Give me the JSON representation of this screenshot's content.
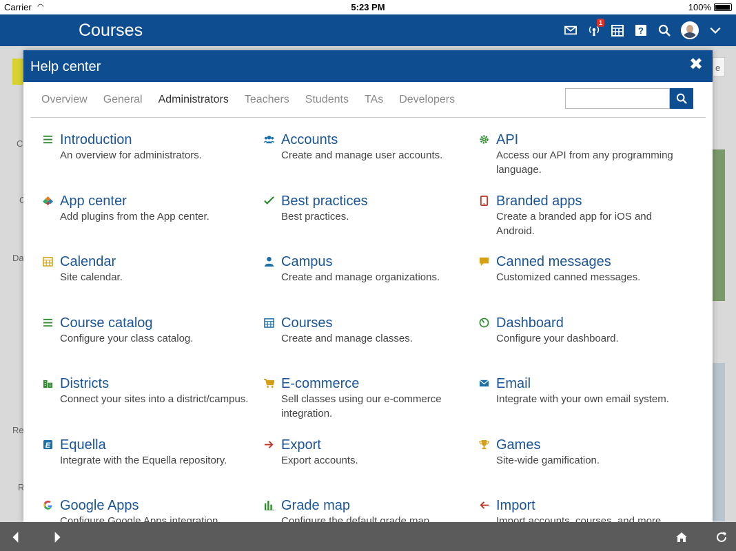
{
  "status_bar": {
    "carrier": "Carrier",
    "time": "5:23 PM",
    "battery": "100%"
  },
  "app": {
    "title": "Courses",
    "notification_count": "1"
  },
  "background_fragments": [
    "C",
    "C",
    "Da",
    "Re",
    "R",
    "e"
  ],
  "modal": {
    "title": "Help center",
    "close_icon": "close-icon",
    "tabs": [
      {
        "label": "Overview"
      },
      {
        "label": "General"
      },
      {
        "label": "Administrators",
        "active": true
      },
      {
        "label": "Teachers"
      },
      {
        "label": "Students"
      },
      {
        "label": "TAs"
      },
      {
        "label": "Developers"
      }
    ],
    "search_placeholder": "",
    "topics": [
      {
        "title": "Introduction",
        "desc": "An overview for administrators.",
        "icon": "list-icon",
        "color": "#2e8b2e"
      },
      {
        "title": "Accounts",
        "desc": "Create and manage user accounts.",
        "icon": "users-icon",
        "color": "#1d6fa5"
      },
      {
        "title": "API",
        "desc": "Access our API from any programming language.",
        "icon": "gear-icon",
        "color": "#2e8b2e"
      },
      {
        "title": "App center",
        "desc": "Add plugins from the App center.",
        "icon": "puzzle-icon",
        "color": "#3a7bd5"
      },
      {
        "title": "Best practices",
        "desc": "Best practices.",
        "icon": "check-icon",
        "color": "#2e8b2e"
      },
      {
        "title": "Branded apps",
        "desc": "Create a branded app for iOS and Android.",
        "icon": "phone-icon",
        "color": "#c0392b"
      },
      {
        "title": "Calendar",
        "desc": "Site calendar.",
        "icon": "calendar-icon",
        "color": "#d4a017"
      },
      {
        "title": "Campus",
        "desc": "Create and manage organizations.",
        "icon": "person-icon",
        "color": "#1d6fa5"
      },
      {
        "title": "Canned messages",
        "desc": "Customized canned messages.",
        "icon": "chat-icon",
        "color": "#d4a017"
      },
      {
        "title": "Course catalog",
        "desc": "Configure your class catalog.",
        "icon": "list-icon",
        "color": "#2e8b2e"
      },
      {
        "title": "Courses",
        "desc": "Create and manage classes.",
        "icon": "calendar-icon",
        "color": "#1d6fa5"
      },
      {
        "title": "Dashboard",
        "desc": "Configure your dashboard.",
        "icon": "gauge-icon",
        "color": "#2e8b2e"
      },
      {
        "title": "Districts",
        "desc": "Connect your sites into a district/campus.",
        "icon": "building-icon",
        "color": "#2e8b2e"
      },
      {
        "title": "E-commerce",
        "desc": "Sell classes using our e-commerce integration.",
        "icon": "cart-icon",
        "color": "#d4a017"
      },
      {
        "title": "Email",
        "desc": "Integrate with your own email system.",
        "icon": "mail-icon",
        "color": "#1d6fa5"
      },
      {
        "title": "Equella",
        "desc": "Integrate with the Equella repository.",
        "icon": "equella-icon",
        "color": "#1d6fa5"
      },
      {
        "title": "Export",
        "desc": "Export accounts.",
        "icon": "arrow-right-icon",
        "color": "#c0392b"
      },
      {
        "title": "Games",
        "desc": "Site-wide gamification.",
        "icon": "trophy-icon",
        "color": "#d4a017"
      },
      {
        "title": "Google Apps",
        "desc": "Configure Google Apps integration.",
        "icon": "google-icon",
        "color": "#4285f4"
      },
      {
        "title": "Grade map",
        "desc": "Configure the default grade map.",
        "icon": "bars-icon",
        "color": "#2e8b2e"
      },
      {
        "title": "Import",
        "desc": "Import accounts, courses, and more.",
        "icon": "arrow-left-icon",
        "color": "#c0392b"
      }
    ]
  }
}
